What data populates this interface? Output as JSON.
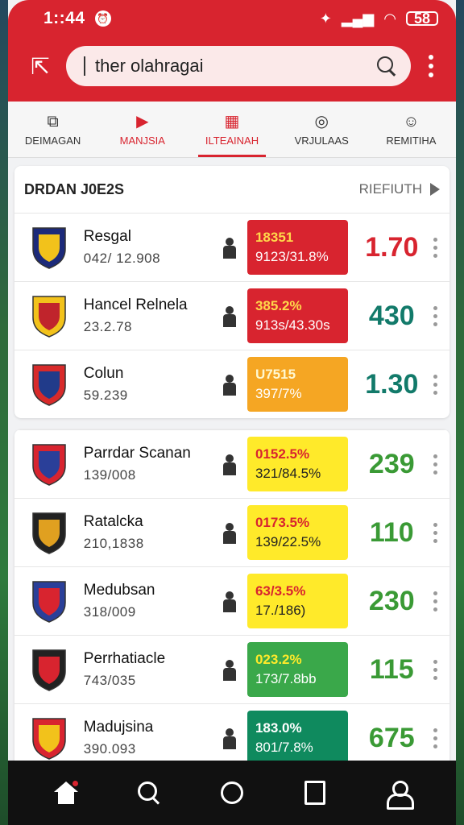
{
  "status": {
    "time": "1::44",
    "battery": "58"
  },
  "search": {
    "value": "ther olahragai"
  },
  "tabs": [
    {
      "label": "DEIMAGAN",
      "icon": "image-icon"
    },
    {
      "label": "MANJSIA",
      "icon": "play-icon"
    },
    {
      "label": "ILTEAINAH",
      "icon": "calendar-icon"
    },
    {
      "label": "VRJULAAS",
      "icon": "compass-icon"
    },
    {
      "label": "REMITIHA",
      "icon": "profile-icon"
    }
  ],
  "section": {
    "title": "DRDAN J0E2S",
    "more": "RIEFIUTH"
  },
  "rows_top": [
    {
      "name": "Resgal",
      "sub": "042/ 12.908",
      "o1": "18351",
      "o2": "9123/31.8%",
      "big": "1.70",
      "odds_color": "#d8242f",
      "big_color": "#d8242f"
    },
    {
      "name": "Hancel Relnela",
      "sub": "23.2.78",
      "o1": "385.2%",
      "o2": "913s/43.30s",
      "big": "430",
      "odds_color": "#d8242f",
      "big_color": "#127a6a"
    },
    {
      "name": "Colun",
      "sub": "59.239",
      "o1": "U7515",
      "o2": "397/7%",
      "big": "1.30",
      "odds_color": "#f5a623",
      "big_color": "#127a6a"
    }
  ],
  "rows_bottom": [
    {
      "name": "Parrdar Scanan",
      "sub": "139/008",
      "o1": "0152.5%",
      "o2": "321/84.5%",
      "big": "239",
      "odds_color": "#ffea2a",
      "big_color": "#3a9a35"
    },
    {
      "name": "Ratalcka",
      "sub": "210,1838",
      "o1": "0173.5%",
      "o2": "139/22.5%",
      "big": "110",
      "odds_color": "#ffea2a",
      "big_color": "#3a9a35"
    },
    {
      "name": "Medubsan",
      "sub": "318/009",
      "o1": "63/3.5%",
      "o2": "17./186)",
      "big": "230",
      "odds_color": "#ffea2a",
      "big_color": "#3a9a35"
    },
    {
      "name": "Perrhatiacle",
      "sub": "743/035",
      "o1": "023.2%",
      "o2": "173/7.8bb",
      "big": "115",
      "odds_color": "#3aa84a",
      "big_color": "#3a9a35"
    },
    {
      "name": "Madujsina",
      "sub": "390.093",
      "o1": "183.0%",
      "o2": "801/7.8%",
      "big": "675",
      "odds_color": "#0f8a5e",
      "big_color": "#3a9a35"
    }
  ],
  "colors": {
    "accent": "#d8242f"
  }
}
